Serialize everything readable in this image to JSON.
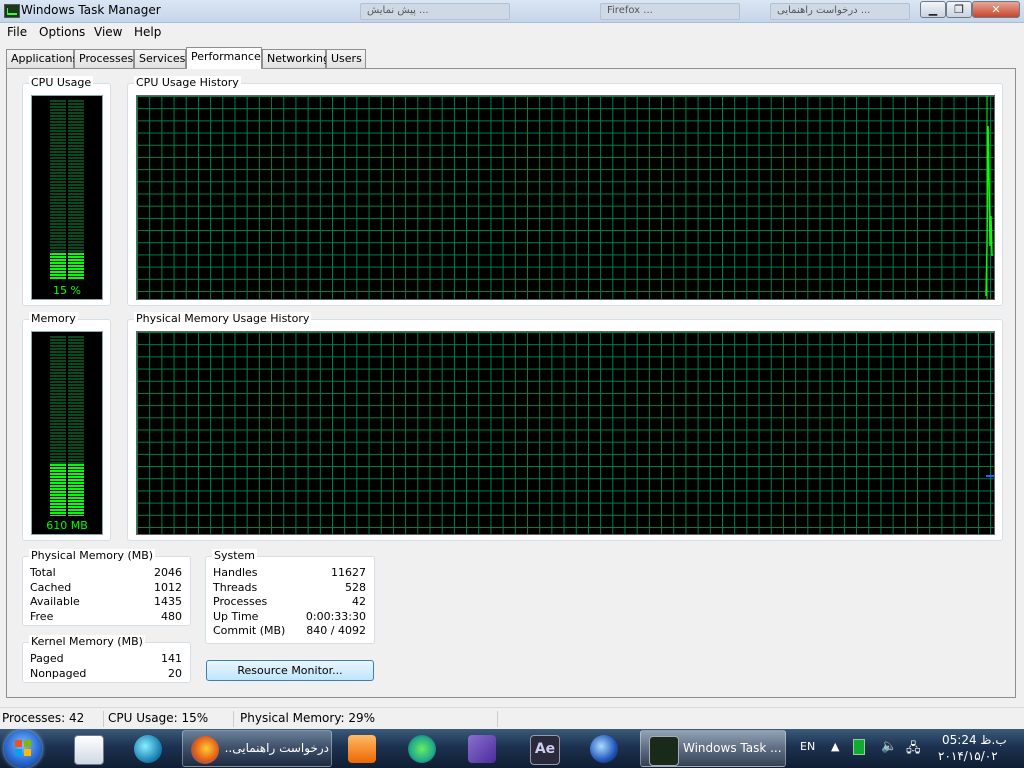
{
  "window": {
    "title": "Windows Task Manager",
    "background_tabs": [
      "پیش نمایش ...",
      "Firefox ...",
      "درخواست راهنمایی ..."
    ],
    "minimize_icon": "minimize-icon",
    "maximize_icon": "maximize-icon",
    "close_icon": "close-icon"
  },
  "menu": [
    "File",
    "Options",
    "View",
    "Help"
  ],
  "tabs": [
    "Applications",
    "Processes",
    "Services",
    "Performance",
    "Networking",
    "Users"
  ],
  "active_tab": "Performance",
  "cpu": {
    "label": "CPU Usage",
    "value_text": "15 %",
    "level": 0.15,
    "history_label": "CPU Usage History"
  },
  "memory": {
    "label": "Memory",
    "value_text": "610 MB",
    "level": 0.29,
    "history_label": "Physical Memory Usage History"
  },
  "physical_memory": {
    "title": "Physical Memory (MB)",
    "rows": [
      {
        "name": "Total",
        "value": "2046"
      },
      {
        "name": "Cached",
        "value": "1012"
      },
      {
        "name": "Available",
        "value": "1435"
      },
      {
        "name": "Free",
        "value": "480"
      }
    ]
  },
  "kernel_memory": {
    "title": "Kernel Memory (MB)",
    "rows": [
      {
        "name": "Paged",
        "value": "141"
      },
      {
        "name": "Nonpaged",
        "value": "20"
      }
    ]
  },
  "system": {
    "title": "System",
    "rows": [
      {
        "name": "Handles",
        "value": "11627"
      },
      {
        "name": "Threads",
        "value": "528"
      },
      {
        "name": "Processes",
        "value": "42"
      },
      {
        "name": "Up Time",
        "value": "0:00:33:30"
      },
      {
        "name": "Commit (MB)",
        "value": "840 / 4092"
      }
    ]
  },
  "resource_monitor_button": "Resource Monitor...",
  "status": {
    "processes": "Processes: 42",
    "cpu": "CPU Usage: 15%",
    "memory": "Physical Memory: 29%"
  },
  "taskbar": {
    "firefox_label": "درخواست راهنمایی...",
    "taskman_label": "Windows Task ...",
    "lang": "EN",
    "time": "05:24 ب.ظ",
    "date": "۲۰۱۴/۱۵/۰۲",
    "colors": {
      "graph_grid": "#00804a",
      "graph_line": "#00ff00",
      "meter_on": "#00ff00"
    }
  }
}
